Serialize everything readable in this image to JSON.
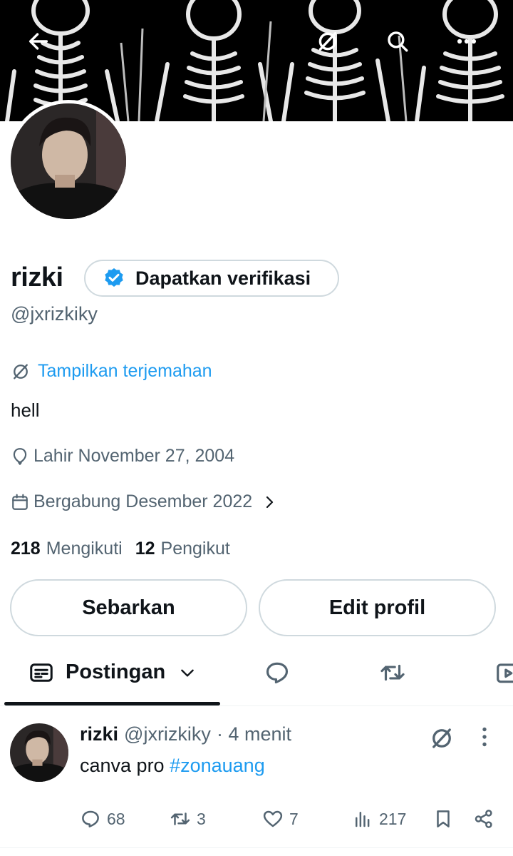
{
  "profile": {
    "name": "rizki",
    "verify_label": "Dapatkan verifikasi",
    "handle": "@jxrizkiky",
    "translate_label": "Tampilkan terjemahan",
    "bio": "hell",
    "birthday": "Lahir November 27, 2004",
    "joined": "Bergabung Desember 2022",
    "following_count": "218",
    "following_label": "Mengikuti",
    "followers_count": "12",
    "followers_label": "Pengikut"
  },
  "buttons": {
    "share_label": "Sebarkan",
    "edit_label": "Edit profil"
  },
  "tabs": {
    "active_label": "Postingan"
  },
  "post": {
    "name": "rizki",
    "handle": "@jxrizkiky",
    "time": "· 4 menit",
    "text": "canva pro ",
    "hashtag": "#zonauang",
    "replies": "68",
    "reposts": "3",
    "likes": "7",
    "views": "217"
  },
  "colors": {
    "accent": "#1d9bf0",
    "text": "#0f1419",
    "secondary": "#536471",
    "border": "#cfd9de"
  },
  "icons": [
    "back-arrow-icon",
    "translate-icon",
    "search-icon",
    "more-options-icon",
    "verified-badge-icon",
    "balloon-icon",
    "calendar-icon",
    "chevron-right-icon",
    "posts-tab-icon",
    "chevron-down-icon",
    "replies-tab-icon",
    "reposts-tab-icon",
    "media-tab-icon",
    "reply-icon",
    "repost-icon",
    "like-icon",
    "views-icon",
    "bookmark-icon",
    "share-icon"
  ]
}
